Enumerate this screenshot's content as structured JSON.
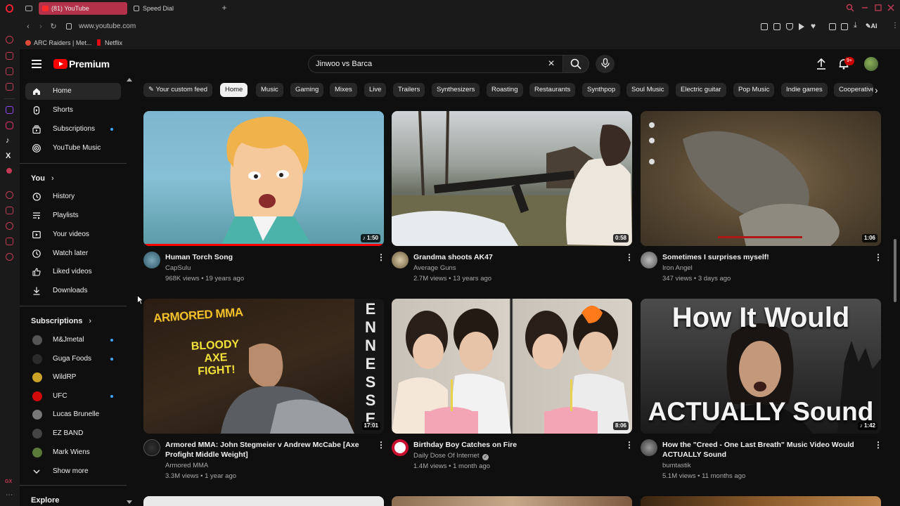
{
  "browser": {
    "tabs": [
      {
        "label": "(81) YouTube"
      },
      {
        "label": "Speed Dial"
      }
    ],
    "url": "www.youtube.com",
    "ai_label": "AI",
    "bookmarks": [
      {
        "label": "ARC Raiders | Met..."
      },
      {
        "label": "Netflix"
      }
    ],
    "gx_label": "GX"
  },
  "masthead": {
    "logo_text": "Premium",
    "search_value": "Jinwoo vs Barca",
    "notification_count": "9+"
  },
  "sidebar": {
    "main": [
      {
        "label": "Home",
        "icon": "home-icon",
        "active": true
      },
      {
        "label": "Shorts",
        "icon": "shorts-icon"
      },
      {
        "label": "Subscriptions",
        "icon": "subscriptions-icon"
      },
      {
        "label": "YouTube Music",
        "icon": "youtube-music-icon"
      }
    ],
    "you_heading": "You",
    "you": [
      {
        "label": "History"
      },
      {
        "label": "Playlists"
      },
      {
        "label": "Your videos"
      },
      {
        "label": "Watch later"
      },
      {
        "label": "Liked videos"
      },
      {
        "label": "Downloads"
      }
    ],
    "subscriptions_heading": "Subscriptions",
    "subscriptions": [
      {
        "label": "M&Jmetal",
        "color": "#555555"
      },
      {
        "label": "Guga Foods",
        "color": "#2b2b2b"
      },
      {
        "label": "WildRP",
        "color": "#c9a227"
      },
      {
        "label": "UFC",
        "color": "#d20a0a"
      },
      {
        "label": "Lucas Brunelle",
        "color": "#777777"
      },
      {
        "label": "EZ BAND",
        "color": "#444444"
      },
      {
        "label": "Mark Wiens",
        "color": "#5a7a3a"
      }
    ],
    "show_more": "Show more",
    "explore_heading": "Explore"
  },
  "chips": [
    {
      "label": "Your custom feed"
    },
    {
      "label": "Home",
      "active": true
    },
    {
      "label": "Music"
    },
    {
      "label": "Gaming"
    },
    {
      "label": "Mixes"
    },
    {
      "label": "Live"
    },
    {
      "label": "Trailers"
    },
    {
      "label": "Synthesizers"
    },
    {
      "label": "Roasting"
    },
    {
      "label": "Restaurants"
    },
    {
      "label": "Synthpop"
    },
    {
      "label": "Soul Music"
    },
    {
      "label": "Electric guitar"
    },
    {
      "label": "Pop Music"
    },
    {
      "label": "Indie games"
    },
    {
      "label": "Cooperative"
    }
  ],
  "videos": [
    {
      "title": "Human Torch Song",
      "channel": "CapSulu",
      "meta": "968K views • 19 years ago",
      "duration": "1:50"
    },
    {
      "title": "Grandma shoots AK47",
      "channel": "Average Guns",
      "meta": "2.7M views • 13 years ago",
      "duration": "0:58"
    },
    {
      "title": "Sometimes I surprises myself!",
      "channel": "Iron Angel",
      "meta": "347 views • 3 days ago",
      "duration": "1:06"
    },
    {
      "title": "Armored MMA: John Stegmeier v Andrew McCabe [Axe Profight Middle Weight]",
      "channel": "Armored MMA",
      "meta": "3.3M views • 1 year ago",
      "duration": "17:01",
      "thumb_text_1": "ARMORED MMA",
      "thumb_text_2": "BLOODY AXE FIGHT!",
      "thumb_text_3": "ENNESSE"
    },
    {
      "title": "Birthday Boy Catches on Fire",
      "channel": "Daily Dose Of Internet",
      "meta": "1.4M views • 1 month ago",
      "duration": "8:06"
    },
    {
      "title": "How the \"Creed - One Last Breath\" Music Video Would ACTUALLY Sound",
      "channel": "bumtastik",
      "meta": "5.1M views • 11 months ago",
      "duration": "1:42",
      "thumb_text_1": "How It Would",
      "thumb_text_2": "ACTUALLY Sound"
    }
  ]
}
